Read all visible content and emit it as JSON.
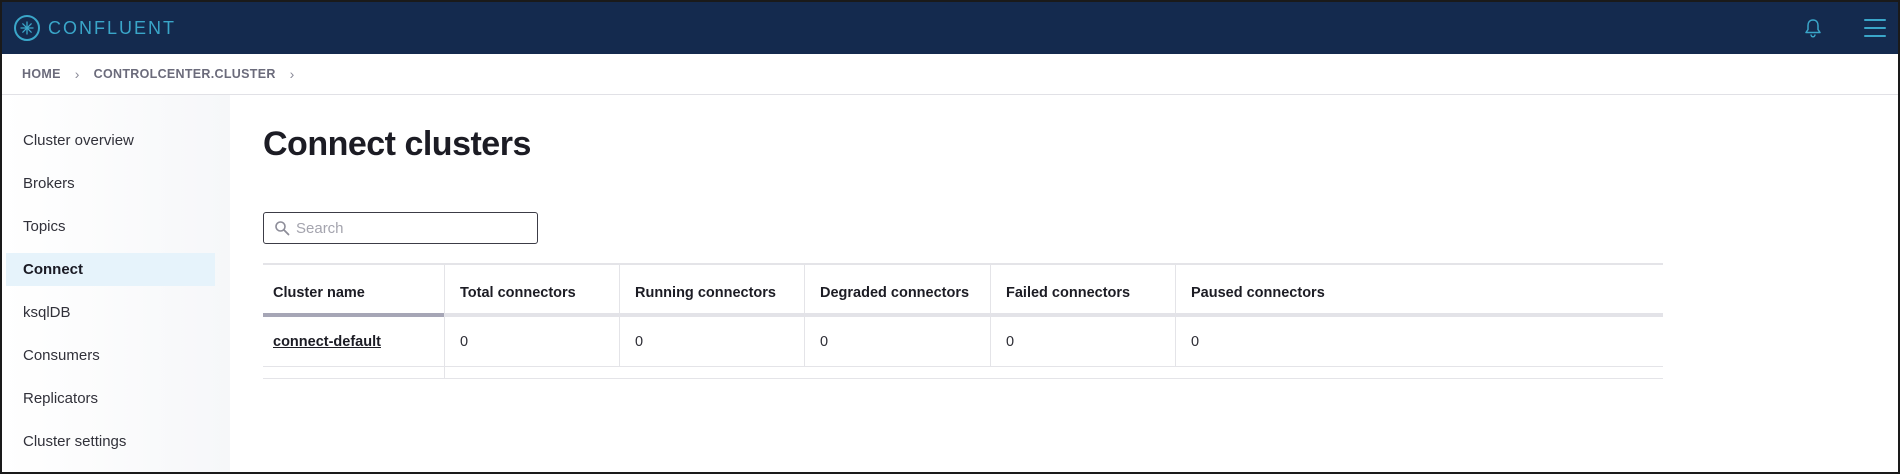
{
  "header": {
    "brand": "CONFLUENT",
    "icons": [
      "confluent-logo-icon",
      "bell-icon",
      "hamburger-menu-icon"
    ]
  },
  "breadcrumb": {
    "items": [
      "HOME",
      "CONTROLCENTER.CLUSTER"
    ],
    "separator": "›"
  },
  "sidebar": {
    "items": [
      {
        "label": "Cluster overview",
        "active": false
      },
      {
        "label": "Brokers",
        "active": false
      },
      {
        "label": "Topics",
        "active": false
      },
      {
        "label": "Connect",
        "active": true
      },
      {
        "label": "ksqlDB",
        "active": false
      },
      {
        "label": "Consumers",
        "active": false
      },
      {
        "label": "Replicators",
        "active": false
      },
      {
        "label": "Cluster settings",
        "active": false
      }
    ]
  },
  "main": {
    "title": "Connect clusters",
    "search": {
      "placeholder": "Search",
      "value": ""
    },
    "table": {
      "columns": [
        "Cluster name",
        "Total connectors",
        "Running connectors",
        "Degraded connectors",
        "Failed connectors",
        "Paused connectors"
      ],
      "rows": [
        [
          "connect-default",
          "0",
          "0",
          "0",
          "0",
          "0"
        ]
      ]
    }
  },
  "colors": {
    "topbar": "#142a4e",
    "brand_accent": "#3aa6c9",
    "active_nav_bg": "#e6f3fb"
  }
}
